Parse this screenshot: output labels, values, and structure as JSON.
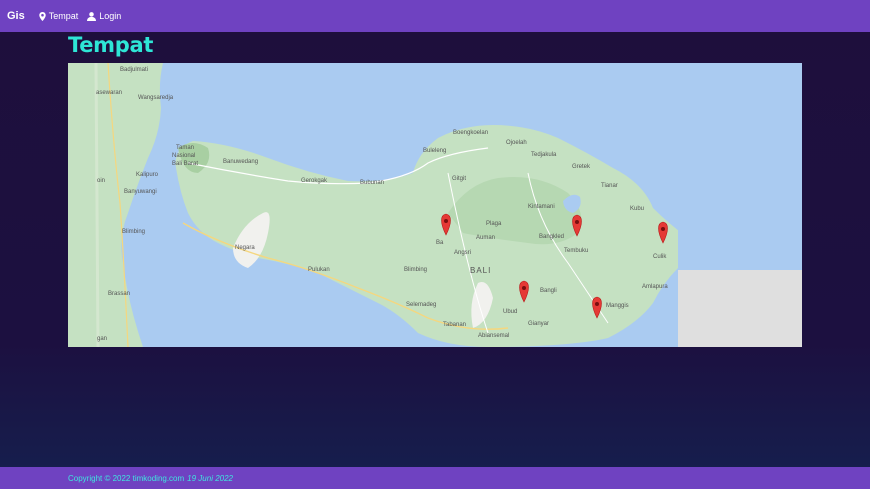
{
  "navbar": {
    "brand": "Gis",
    "links": [
      {
        "label": "Tempat",
        "icon": "map-marker-icon"
      },
      {
        "label": "Login",
        "icon": "user-icon"
      }
    ]
  },
  "page": {
    "title": "Tempat"
  },
  "map": {
    "labels": [
      {
        "text": "Badjulmati"
      },
      {
        "text": "asewaran"
      },
      {
        "text": "Wangsaredja"
      },
      {
        "text": "Boengkoelan"
      },
      {
        "text": "Ojoelah"
      },
      {
        "text": "Taman"
      },
      {
        "text": "Nasional"
      },
      {
        "text": "Bali Barat"
      },
      {
        "text": "Banuwedang"
      },
      {
        "text": "Buleleng"
      },
      {
        "text": "Tedjakula"
      },
      {
        "text": "Gretek"
      },
      {
        "text": "Kalipuro"
      },
      {
        "text": "Gerokgak"
      },
      {
        "text": "Bubunan"
      },
      {
        "text": "Gitgit"
      },
      {
        "text": "Tianar"
      },
      {
        "text": "oin"
      },
      {
        "text": "Banyuwangi"
      },
      {
        "text": "Kintamani"
      },
      {
        "text": "Kubu"
      },
      {
        "text": "Plaga"
      },
      {
        "text": "Blimbing"
      },
      {
        "text": "Auman"
      },
      {
        "text": "Bangkled"
      },
      {
        "text": "Negara"
      },
      {
        "text": "Ba"
      },
      {
        "text": "Angsri"
      },
      {
        "text": "Culik"
      },
      {
        "text": "BALI"
      },
      {
        "text": "Pulukan"
      },
      {
        "text": "Blimbing"
      },
      {
        "text": "Tembuku"
      },
      {
        "text": "Amlapura"
      },
      {
        "text": "Bangli"
      },
      {
        "text": "Brassan"
      },
      {
        "text": "Selemadeg"
      },
      {
        "text": "Manggis"
      },
      {
        "text": "Ubud"
      },
      {
        "text": "Tabanan"
      },
      {
        "text": "Gianyar"
      },
      {
        "text": "gan"
      },
      {
        "text": "Abiansemal"
      }
    ],
    "markers": [
      {
        "name": "marker-1",
        "icon": "map-pin-icon"
      },
      {
        "name": "marker-2",
        "icon": "map-pin-icon"
      },
      {
        "name": "marker-3",
        "icon": "map-pin-icon"
      },
      {
        "name": "marker-4",
        "icon": "map-pin-icon"
      },
      {
        "name": "marker-5",
        "icon": "map-pin-icon"
      }
    ],
    "colors": {
      "water": "#aacbf1",
      "land": "#c5e1c2",
      "marker": "#e53935"
    }
  },
  "footer": {
    "copyright": "Copyright © 2022 timkoding.com",
    "date": "19 Juni 2022"
  }
}
